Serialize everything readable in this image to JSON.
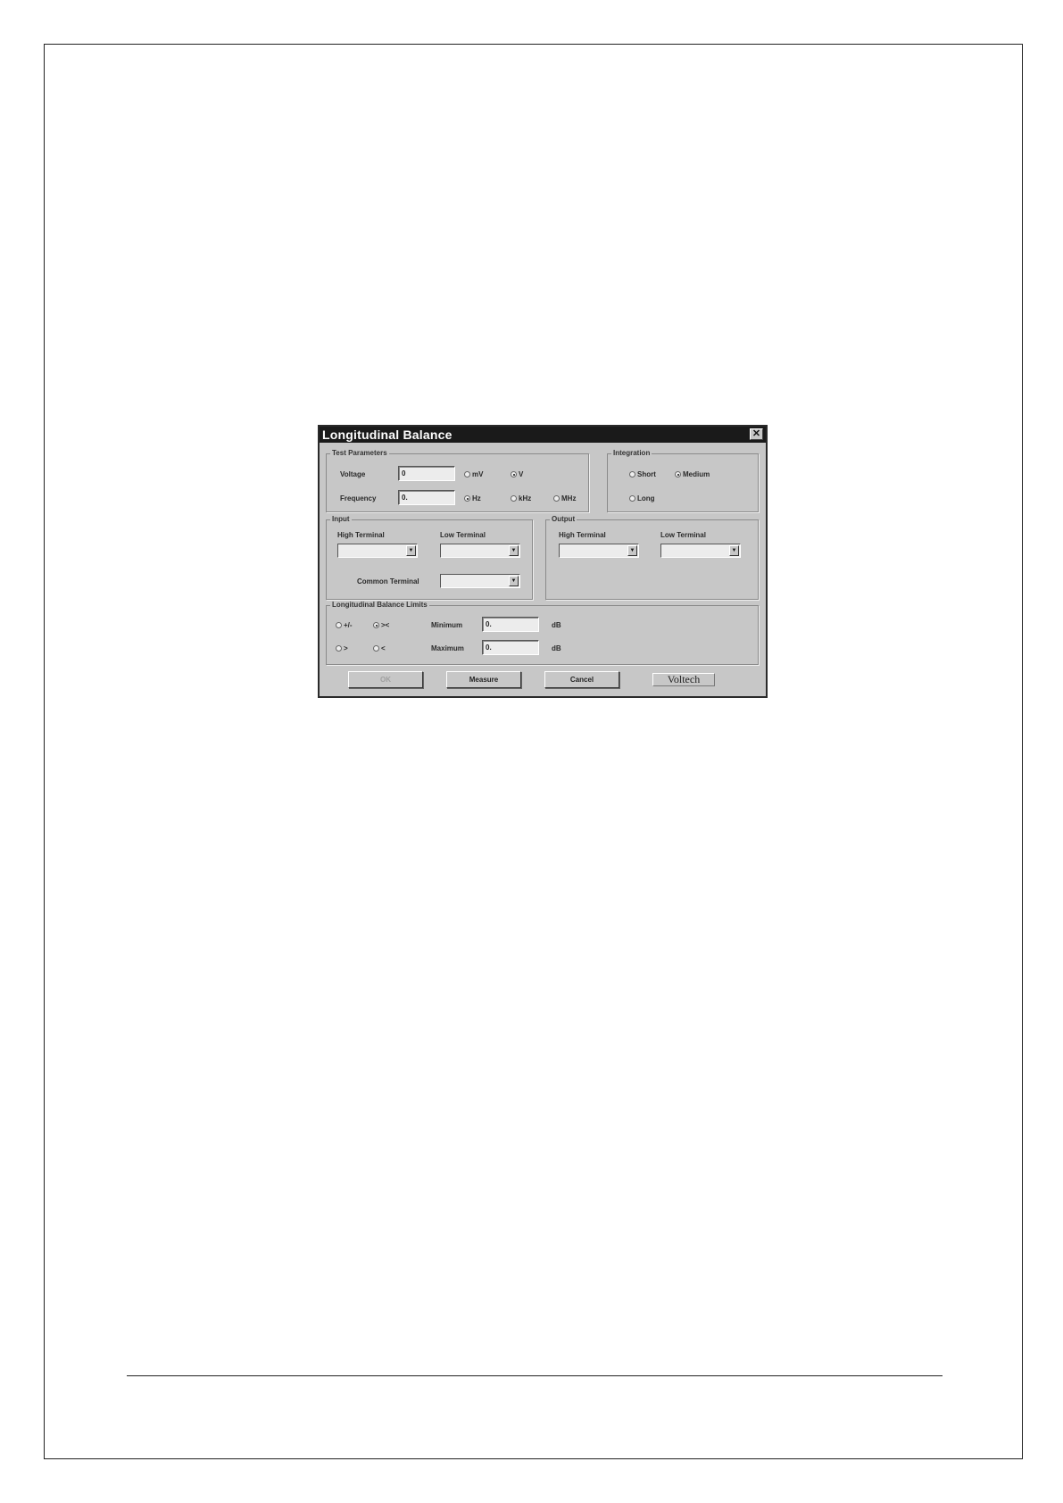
{
  "dialog": {
    "title": "Longitudinal Balance",
    "close_glyph": "✕",
    "test_parameters": {
      "label": "Test Parameters",
      "voltage_label": "Voltage",
      "voltage_value": "0",
      "voltage_units": [
        {
          "label": "mV",
          "selected": false
        },
        {
          "label": "V",
          "selected": true
        }
      ],
      "frequency_label": "Frequency",
      "frequency_value": "0.",
      "frequency_units": [
        {
          "label": "Hz",
          "selected": true
        },
        {
          "label": "kHz",
          "selected": false
        },
        {
          "label": "MHz",
          "selected": false
        }
      ]
    },
    "integration": {
      "label": "Integration",
      "options": [
        {
          "label": "Short",
          "selected": false
        },
        {
          "label": "Medium",
          "selected": true
        },
        {
          "label": "Long",
          "selected": false
        }
      ]
    },
    "input": {
      "label": "Input",
      "high_terminal_label": "High Terminal",
      "low_terminal_label": "Low Terminal",
      "common_terminal_label": "Common Terminal",
      "high_terminal_value": "",
      "low_terminal_value": "",
      "common_terminal_value": ""
    },
    "output": {
      "label": "Output",
      "high_terminal_label": "High Terminal",
      "low_terminal_label": "Low Terminal",
      "high_terminal_value": "",
      "low_terminal_value": ""
    },
    "limits": {
      "label": "Longitudinal Balance Limits",
      "comparators": [
        {
          "label": "+/-",
          "selected": false
        },
        {
          "label": "><",
          "selected": true
        },
        {
          "label": ">",
          "selected": false
        },
        {
          "label": "<",
          "selected": false
        }
      ],
      "minimum_label": "Minimum",
      "minimum_value": "0.",
      "maximum_label": "Maximum",
      "maximum_value": "0.",
      "unit": "dB"
    },
    "buttons": {
      "ok": "OK",
      "measure": "Measure",
      "cancel": "Cancel",
      "brand": "Voltech"
    }
  }
}
